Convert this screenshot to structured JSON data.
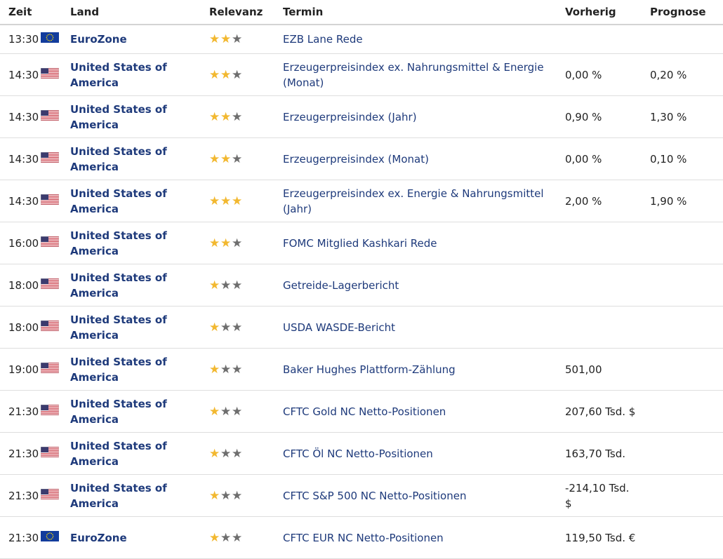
{
  "headers": {
    "time": "Zeit",
    "land": "Land",
    "relevance": "Relevanz",
    "event": "Termin",
    "previous": "Vorherig",
    "forecast": "Prognose"
  },
  "colors": {
    "star_active": "#f2b830",
    "star_inactive": "#6e6e6e",
    "link_text": "#1e3a7b"
  },
  "rows": [
    {
      "time": "13:30",
      "flag": "eu-flag-icon",
      "country": "EuroZone",
      "stars": 2,
      "event": "EZB Lane Rede",
      "previous": "",
      "forecast": ""
    },
    {
      "time": "14:30",
      "flag": "us-flag-icon",
      "country": "United States of America",
      "stars": 2,
      "event": "Erzeugerpreisindex ex. Nahrungsmittel & Energie (Monat)",
      "previous": "0,00 %",
      "forecast": "0,20 %"
    },
    {
      "time": "14:30",
      "flag": "us-flag-icon",
      "country": "United States of America",
      "stars": 2,
      "event": "Erzeugerpreisindex (Jahr)",
      "previous": "0,90 %",
      "forecast": "1,30 %"
    },
    {
      "time": "14:30",
      "flag": "us-flag-icon",
      "country": "United States of America",
      "stars": 2,
      "event": "Erzeugerpreisindex (Monat)",
      "previous": "0,00 %",
      "forecast": "0,10 %"
    },
    {
      "time": "14:30",
      "flag": "us-flag-icon",
      "country": "United States of America",
      "stars": 3,
      "event": "Erzeugerpreisindex ex. Energie & Nahrungsmittel (Jahr)",
      "previous": "2,00 %",
      "forecast": "1,90 %"
    },
    {
      "time": "16:00",
      "flag": "us-flag-icon",
      "country": "United States of America",
      "stars": 2,
      "event": "FOMC Mitglied Kashkari Rede",
      "previous": "",
      "forecast": ""
    },
    {
      "time": "18:00",
      "flag": "us-flag-icon",
      "country": "United States of America",
      "stars": 1,
      "event": "Getreide-Lagerbericht",
      "previous": "",
      "forecast": ""
    },
    {
      "time": "18:00",
      "flag": "us-flag-icon",
      "country": "United States of America",
      "stars": 1,
      "event": "USDA WASDE-Bericht",
      "previous": "",
      "forecast": ""
    },
    {
      "time": "19:00",
      "flag": "us-flag-icon",
      "country": "United States of America",
      "stars": 1,
      "event": "Baker Hughes Plattform-Zählung",
      "previous": "501,00",
      "forecast": ""
    },
    {
      "time": "21:30",
      "flag": "us-flag-icon",
      "country": "United States of America",
      "stars": 1,
      "event": "CFTC Gold NC Netto-Positionen",
      "previous": "207,60 Tsd. $",
      "forecast": ""
    },
    {
      "time": "21:30",
      "flag": "us-flag-icon",
      "country": "United States of America",
      "stars": 1,
      "event": "CFTC Öl NC Netto-Positionen",
      "previous": "163,70 Tsd.",
      "forecast": ""
    },
    {
      "time": "21:30",
      "flag": "us-flag-icon",
      "country": "United States of America",
      "stars": 1,
      "event": "CFTC S&P 500 NC Netto-Positionen",
      "previous": "-214,10 Tsd. $",
      "forecast": ""
    },
    {
      "time": "21:30",
      "flag": "eu-flag-icon",
      "country": "EuroZone",
      "stars": 1,
      "event": "CFTC EUR NC Netto-Positionen",
      "previous": "119,50 Tsd. €",
      "forecast": ""
    }
  ]
}
